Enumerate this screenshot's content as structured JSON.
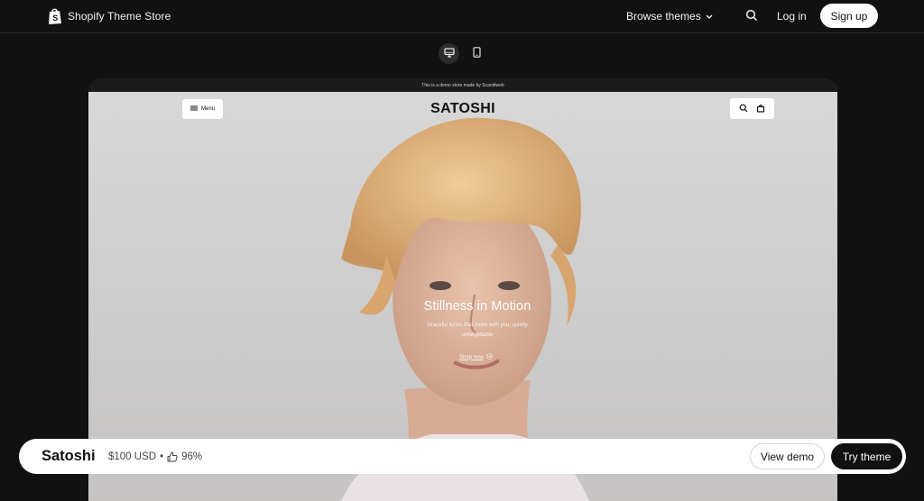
{
  "nav": {
    "brand": "Shopify Theme Store",
    "browse_label": "Browse themes",
    "login_label": "Log in",
    "signup_label": "Sign up"
  },
  "preview": {
    "demo_banner": "This is a demo store made by Scandiweb",
    "menu_label": "Menu",
    "store_name": "SATOSHI",
    "hero_title": "Stillness in Motion",
    "hero_subtitle": "Graceful forms that move with you, quietly unforgettable",
    "hero_link": "Shop now"
  },
  "theme_bar": {
    "name": "Satoshi",
    "price": "$100 USD",
    "separator": "•",
    "rating": "96%",
    "view_demo_label": "View demo",
    "try_theme_label": "Try theme"
  },
  "icons": [
    "shopify-bag-icon",
    "chevron-down-icon",
    "search-icon",
    "desktop-icon",
    "mobile-icon",
    "hamburger-icon",
    "cart-icon",
    "arrow-circle-icon",
    "thumbs-up-icon"
  ],
  "colors": {
    "background": "#111111",
    "accent": "#111111",
    "surface": "#ffffff"
  }
}
